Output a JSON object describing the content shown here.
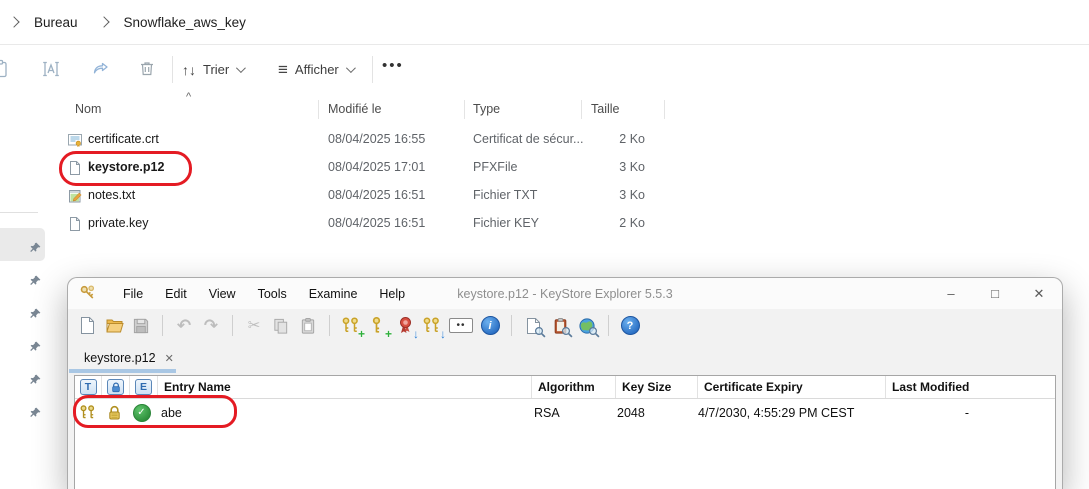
{
  "colors": {
    "annotation_red": "#e41b23",
    "kse_tab_underline": "#a9c7e4",
    "kse_header_icon_blue": "#3f7fc4",
    "key_gold": "#c9a227"
  },
  "glyphs": {
    "sort_arrows": "↑↓",
    "view_lines": "≡",
    "more_dots": "•••",
    "sort_caret": "^",
    "tab_close": "✕",
    "minimize": "–",
    "maximize": "□",
    "close": "✕",
    "undo": "↶",
    "redo": "↷",
    "cut": "✂",
    "password_dots": "••",
    "info_letter": "i",
    "help_mark": "?",
    "check": "✓"
  },
  "explorer": {
    "breadcrumb": {
      "items": [
        "Bureau",
        "Snowflake_aws_key"
      ]
    },
    "toolbar": {
      "sort_label": "Trier",
      "view_label": "Afficher"
    },
    "list": {
      "columns": [
        "Nom",
        "Modifié le",
        "Type",
        "Taille"
      ],
      "files": [
        {
          "name": "certificate.crt",
          "modified": "08/04/2025 16:55",
          "type": "Certificat de sécur...",
          "size": "2 Ko"
        },
        {
          "name": "keystore.p12",
          "modified": "08/04/2025 17:01",
          "type": "PFXFile",
          "size": "3 Ko"
        },
        {
          "name": "notes.txt",
          "modified": "08/04/2025 16:51",
          "type": "Fichier TXT",
          "size": "3 Ko"
        },
        {
          "name": "private.key",
          "modified": "08/04/2025 16:51",
          "type": "Fichier KEY",
          "size": "2 Ko"
        }
      ]
    }
  },
  "keystore_explorer": {
    "title": "keystore.p12 - KeyStore Explorer 5.5.3",
    "menus": [
      "File",
      "Edit",
      "View",
      "Tools",
      "Examine",
      "Help"
    ],
    "tab_label": "keystore.p12",
    "table": {
      "columns": {
        "t": "T",
        "e": "E",
        "entry_name": "Entry Name",
        "algorithm": "Algorithm",
        "key_size": "Key Size",
        "certificate_expiry": "Certificate Expiry",
        "last_modified": "Last Modified"
      },
      "rows": [
        {
          "entry_name": "abe",
          "algorithm": "RSA",
          "key_size": "2048",
          "certificate_expiry": "4/7/2030, 4:55:29 PM CEST",
          "last_modified": "-"
        }
      ]
    }
  }
}
